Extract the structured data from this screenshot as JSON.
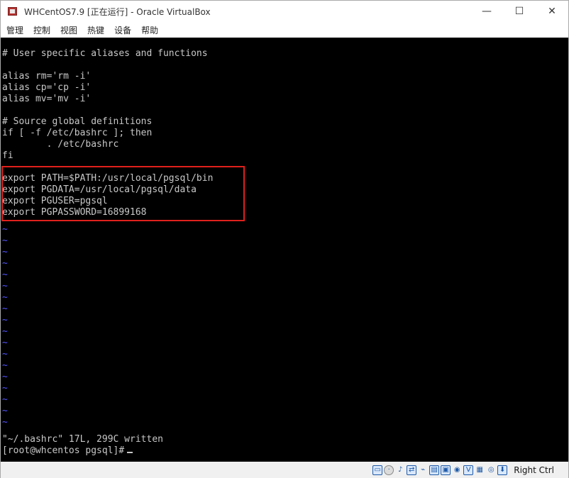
{
  "window": {
    "title": "WHCentOS7.9 [正在运行] - Oracle VirtualBox",
    "controls": {
      "minimize": "—",
      "maximize": "☐",
      "close": "✕"
    }
  },
  "menubar": {
    "items": [
      "管理",
      "控制",
      "视图",
      "热键",
      "设备",
      "帮助"
    ]
  },
  "terminal": {
    "lines": [
      "# User specific aliases and functions",
      "",
      "alias rm='rm -i'",
      "alias cp='cp -i'",
      "alias mv='mv -i'",
      "",
      "# Source global definitions",
      "if [ -f /etc/bashrc ]; then",
      "        . /etc/bashrc",
      "fi",
      "",
      "export PATH=$PATH:/usr/local/pgsql/bin",
      "export PGDATA=/usr/local/pgsql/data",
      "export PGUSER=pgsql",
      "export PGPASSWORD=16899168"
    ],
    "tilde": "~",
    "status_line": "\"~/.bashrc\" 17L, 299C written",
    "prompt": "[root@whcentos pgsql]#"
  },
  "statusbar": {
    "icons": [
      "hdd-icon",
      "optical-disc-icon",
      "audio-icon",
      "network-icon",
      "usb-icon",
      "shared-folder-icon",
      "display-icon",
      "video-capture-icon",
      "virtualization-icon",
      "cpu-icon",
      "mouse-integration-icon",
      "host-key-arrow-icon"
    ],
    "host_key": "Right Ctrl"
  },
  "colors": {
    "terminal_bg": "#000000",
    "terminal_text": "#c8c8c8",
    "tilde": "#5555ff",
    "highlight_box": "#e0201c"
  }
}
